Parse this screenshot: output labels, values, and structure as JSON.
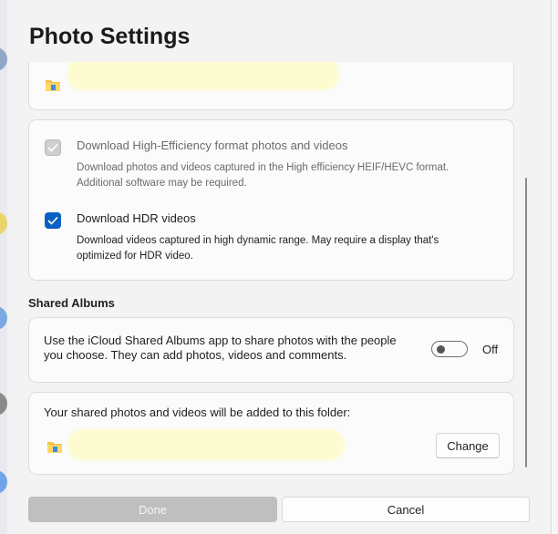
{
  "dialog": {
    "title": "Photo Settings"
  },
  "options": {
    "heif": {
      "label": "Download High-Efficiency format photos and videos",
      "description": "Download photos and videos captured in the High efficiency HEIF/HEVC format. Additional software may be required.",
      "checked": true,
      "disabled": true
    },
    "hdr": {
      "label": "Download HDR videos",
      "description": "Download videos captured in high dynamic range. May require a display that's optimized for HDR video.",
      "checked": true,
      "disabled": false
    }
  },
  "shared_albums": {
    "section_label": "Shared Albums",
    "toggle_description": "Use the iCloud Shared Albums app to share photos with the people you choose. They can add photos, videos and comments.",
    "toggle_state_label": "Off",
    "toggle_on": false,
    "folder_caption": "Your shared photos and videos will be added to this folder:",
    "change_label": "Change"
  },
  "footer": {
    "done_label": "Done",
    "cancel_label": "Cancel"
  },
  "icons": {
    "folder": "folder-icon",
    "check": "checkmark-icon"
  },
  "colors": {
    "accent": "#0b60c4",
    "redaction": "#fdfbd0",
    "done_disabled": "#bfbfbf"
  }
}
